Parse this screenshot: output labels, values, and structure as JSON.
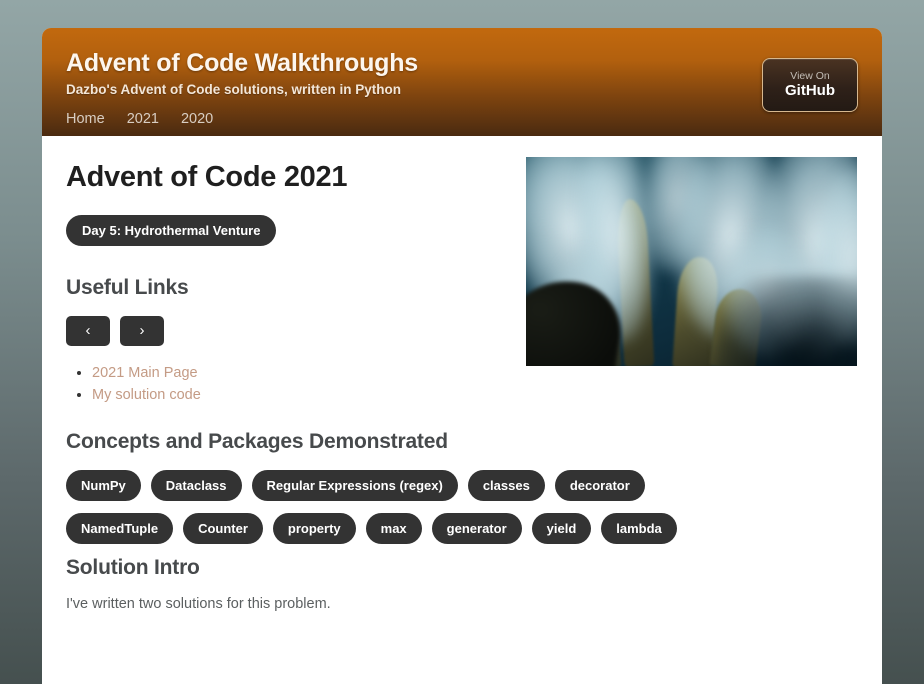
{
  "header": {
    "title": "Advent of Code Walkthroughs",
    "tagline": "Dazbo's Advent of Code solutions, written in Python",
    "nav": [
      {
        "label": "Home"
      },
      {
        "label": "2021"
      },
      {
        "label": "2020"
      }
    ],
    "github_button": {
      "line1": "View On",
      "line2": "GitHub"
    }
  },
  "main": {
    "page_title": "Advent of Code 2021",
    "day_badge": "Day 5: Hydrothermal Venture",
    "useful_links": {
      "heading": "Useful Links",
      "pager": {
        "prev": "‹",
        "next": "›"
      },
      "links": [
        {
          "label": "2021 Main Page"
        },
        {
          "label": "My solution code"
        }
      ]
    },
    "concepts": {
      "heading": "Concepts and Packages Demonstrated",
      "rows": [
        [
          {
            "label": "NumPy"
          },
          {
            "label": "Dataclass"
          },
          {
            "label": "Regular Expressions (regex)"
          },
          {
            "label": "classes"
          },
          {
            "label": "decorator"
          }
        ],
        [
          {
            "label": "NamedTuple"
          },
          {
            "label": "Counter"
          },
          {
            "label": "property"
          },
          {
            "label": "max"
          },
          {
            "label": "generator"
          },
          {
            "label": "yield"
          },
          {
            "label": "lambda"
          }
        ]
      ]
    },
    "solution_intro": {
      "heading": "Solution Intro",
      "paragraph": "I've written two solutions for this problem."
    },
    "hero_image_alt": "hydrothermal-vent-photo"
  },
  "colors": {
    "header_gradient_top": "#c2690e",
    "header_gradient_bottom": "#4a2a10",
    "badge_background": "#333333",
    "link_color": "#c49b85",
    "heading_color": "#474a4c",
    "page_background_top": "#93a6a6",
    "page_background_bottom": "#45504f"
  }
}
